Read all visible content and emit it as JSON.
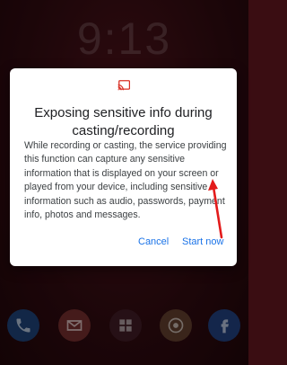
{
  "lock_screen": {
    "time": "9:13",
    "dock_apps": [
      {
        "name": "phone-icon"
      },
      {
        "name": "gmail-icon"
      },
      {
        "name": "app-icon"
      },
      {
        "name": "chrome-icon"
      },
      {
        "name": "facebook-icon"
      }
    ]
  },
  "dialog": {
    "icon": "cast-icon",
    "title": "Exposing sensitive info during casting/recording",
    "body": "While recording or casting, the service providing this function can capture any sensitive information that is displayed on your screen or played from your device, including sensitive information such as audio, passwords, payment info, photos and messages.",
    "cancel_label": "Cancel",
    "start_label": "Start now"
  },
  "colors": {
    "accent": "#1a73e8",
    "annotation_arrow": "#e31b1b",
    "wallpaper": "#3a0d12"
  }
}
